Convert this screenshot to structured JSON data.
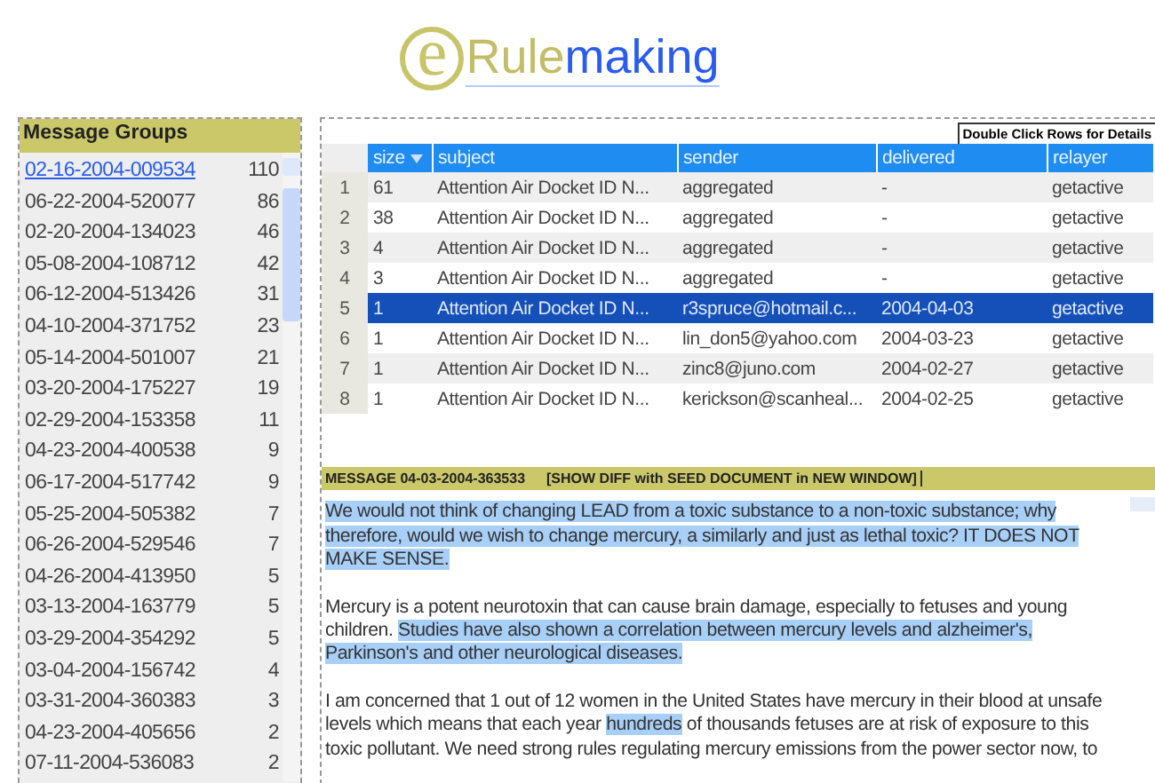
{
  "logo": {
    "letter": "e",
    "first": "Rule",
    "second": "making"
  },
  "message_groups": {
    "title": "Message Groups",
    "items": [
      {
        "id": "02-16-2004-009534",
        "count": "110",
        "selected": true
      },
      {
        "id": "06-22-2004-520077",
        "count": "86",
        "selected": false
      },
      {
        "id": "02-20-2004-134023",
        "count": "46",
        "selected": false
      },
      {
        "id": "05-08-2004-108712",
        "count": "42",
        "selected": false
      },
      {
        "id": "06-12-2004-513426",
        "count": "31",
        "selected": false
      },
      {
        "id": "04-10-2004-371752",
        "count": "23",
        "selected": false
      },
      {
        "id": "05-14-2004-501007",
        "count": "21",
        "selected": false
      },
      {
        "id": "03-20-2004-175227",
        "count": "19",
        "selected": false
      },
      {
        "id": "02-29-2004-153358",
        "count": "11",
        "selected": false
      },
      {
        "id": "04-23-2004-400538",
        "count": "9",
        "selected": false
      },
      {
        "id": "06-17-2004-517742",
        "count": "9",
        "selected": false
      },
      {
        "id": "05-25-2004-505382",
        "count": "7",
        "selected": false
      },
      {
        "id": "06-26-2004-529546",
        "count": "7",
        "selected": false
      },
      {
        "id": "04-26-2004-413950",
        "count": "5",
        "selected": false
      },
      {
        "id": "03-13-2004-163779",
        "count": "5",
        "selected": false
      },
      {
        "id": "03-29-2004-354292",
        "count": "5",
        "selected": false
      },
      {
        "id": "03-04-2004-156742",
        "count": "4",
        "selected": false
      },
      {
        "id": "03-31-2004-360383",
        "count": "3",
        "selected": false
      },
      {
        "id": "04-23-2004-405656",
        "count": "2",
        "selected": false
      },
      {
        "id": "07-11-2004-536083",
        "count": "2",
        "selected": false
      }
    ]
  },
  "details_button": "Double Click Rows for Details",
  "table": {
    "columns": [
      "size",
      "subject",
      "sender",
      "delivered",
      "relayer"
    ],
    "rows": [
      {
        "num": "1",
        "size": "61",
        "subject": "Attention Air Docket ID N...",
        "sender": "aggregated",
        "delivered": "-",
        "relayer": "getactive",
        "selected": false
      },
      {
        "num": "2",
        "size": "38",
        "subject": "Attention Air Docket ID N...",
        "sender": "aggregated",
        "delivered": "-",
        "relayer": "getactive",
        "selected": false
      },
      {
        "num": "3",
        "size": "4",
        "subject": "Attention Air Docket ID N...",
        "sender": "aggregated",
        "delivered": "-",
        "relayer": "getactive",
        "selected": false
      },
      {
        "num": "4",
        "size": "3",
        "subject": "Attention Air Docket ID N...",
        "sender": "aggregated",
        "delivered": "-",
        "relayer": "getactive",
        "selected": false
      },
      {
        "num": "5",
        "size": "1",
        "subject": "Attention Air Docket ID N...",
        "sender": "r3spruce@hotmail.c...",
        "delivered": "2004-04-03",
        "relayer": "getactive",
        "selected": true
      },
      {
        "num": "6",
        "size": "1",
        "subject": "Attention Air Docket ID N...",
        "sender": "lin_don5@yahoo.com",
        "delivered": "2004-03-23",
        "relayer": "getactive",
        "selected": false
      },
      {
        "num": "7",
        "size": "1",
        "subject": "Attention Air Docket ID N...",
        "sender": "zinc8@juno.com",
        "delivered": "2004-02-27",
        "relayer": "getactive",
        "selected": false
      },
      {
        "num": "8",
        "size": "1",
        "subject": "Attention Air Docket ID N...",
        "sender": "kerickson@scanheal...",
        "delivered": "2004-02-25",
        "relayer": "getactive",
        "selected": false
      }
    ]
  },
  "message": {
    "title": "MESSAGE 04-03-2004-363533",
    "diff_link": "[SHOW DIFF with SEED DOCUMENT in NEW WINDOW]",
    "paragraphs": [
      [
        {
          "text": "We would not think of changing LEAD from a toxic substance to a non-toxic substance; why therefore, would we wish to change mercury, a similarly and just as lethal toxic? IT DOES NOT MAKE SENSE.",
          "highlighted": true
        }
      ],
      [
        {
          "text": "Mercury is a potent neurotoxin that can cause brain damage, especially to fetuses and young children. ",
          "highlighted": false
        },
        {
          "text": "Studies have also shown a correlation between mercury levels and alzheimer's, Parkinson's and other neurological diseases.",
          "highlighted": true
        }
      ],
      [
        {
          "text": "I am concerned that 1 out of 12 women in the United States have mercury in their blood at unsafe levels which means that each year ",
          "highlighted": false
        },
        {
          "text": "hundreds",
          "highlighted": true
        },
        {
          "text": " of thousands fetuses are at risk of exposure to this toxic pollutant. We need strong rules regulating mercury emissions from the power sector now, to",
          "highlighted": false
        }
      ]
    ]
  }
}
